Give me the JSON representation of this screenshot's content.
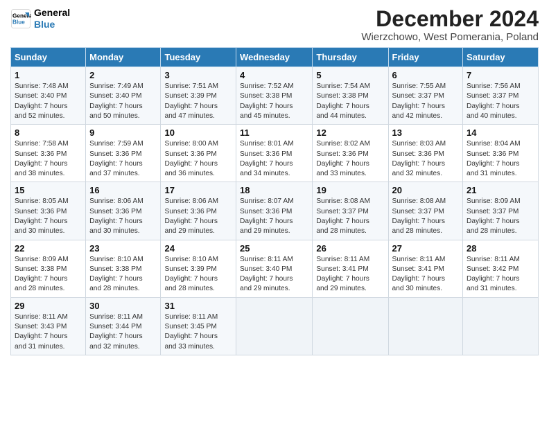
{
  "logo": {
    "line1": "General",
    "line2": "Blue"
  },
  "title": "December 2024",
  "subtitle": "Wierzchowo, West Pomerania, Poland",
  "days_of_week": [
    "Sunday",
    "Monday",
    "Tuesday",
    "Wednesday",
    "Thursday",
    "Friday",
    "Saturday"
  ],
  "weeks": [
    [
      {
        "day": 1,
        "content": "Sunrise: 7:48 AM\nSunset: 3:40 PM\nDaylight: 7 hours\nand 52 minutes."
      },
      {
        "day": 2,
        "content": "Sunrise: 7:49 AM\nSunset: 3:40 PM\nDaylight: 7 hours\nand 50 minutes."
      },
      {
        "day": 3,
        "content": "Sunrise: 7:51 AM\nSunset: 3:39 PM\nDaylight: 7 hours\nand 47 minutes."
      },
      {
        "day": 4,
        "content": "Sunrise: 7:52 AM\nSunset: 3:38 PM\nDaylight: 7 hours\nand 45 minutes."
      },
      {
        "day": 5,
        "content": "Sunrise: 7:54 AM\nSunset: 3:38 PM\nDaylight: 7 hours\nand 44 minutes."
      },
      {
        "day": 6,
        "content": "Sunrise: 7:55 AM\nSunset: 3:37 PM\nDaylight: 7 hours\nand 42 minutes."
      },
      {
        "day": 7,
        "content": "Sunrise: 7:56 AM\nSunset: 3:37 PM\nDaylight: 7 hours\nand 40 minutes."
      }
    ],
    [
      {
        "day": 8,
        "content": "Sunrise: 7:58 AM\nSunset: 3:36 PM\nDaylight: 7 hours\nand 38 minutes."
      },
      {
        "day": 9,
        "content": "Sunrise: 7:59 AM\nSunset: 3:36 PM\nDaylight: 7 hours\nand 37 minutes."
      },
      {
        "day": 10,
        "content": "Sunrise: 8:00 AM\nSunset: 3:36 PM\nDaylight: 7 hours\nand 36 minutes."
      },
      {
        "day": 11,
        "content": "Sunrise: 8:01 AM\nSunset: 3:36 PM\nDaylight: 7 hours\nand 34 minutes."
      },
      {
        "day": 12,
        "content": "Sunrise: 8:02 AM\nSunset: 3:36 PM\nDaylight: 7 hours\nand 33 minutes."
      },
      {
        "day": 13,
        "content": "Sunrise: 8:03 AM\nSunset: 3:36 PM\nDaylight: 7 hours\nand 32 minutes."
      },
      {
        "day": 14,
        "content": "Sunrise: 8:04 AM\nSunset: 3:36 PM\nDaylight: 7 hours\nand 31 minutes."
      }
    ],
    [
      {
        "day": 15,
        "content": "Sunrise: 8:05 AM\nSunset: 3:36 PM\nDaylight: 7 hours\nand 30 minutes."
      },
      {
        "day": 16,
        "content": "Sunrise: 8:06 AM\nSunset: 3:36 PM\nDaylight: 7 hours\nand 30 minutes."
      },
      {
        "day": 17,
        "content": "Sunrise: 8:06 AM\nSunset: 3:36 PM\nDaylight: 7 hours\nand 29 minutes."
      },
      {
        "day": 18,
        "content": "Sunrise: 8:07 AM\nSunset: 3:36 PM\nDaylight: 7 hours\nand 29 minutes."
      },
      {
        "day": 19,
        "content": "Sunrise: 8:08 AM\nSunset: 3:37 PM\nDaylight: 7 hours\nand 28 minutes."
      },
      {
        "day": 20,
        "content": "Sunrise: 8:08 AM\nSunset: 3:37 PM\nDaylight: 7 hours\nand 28 minutes."
      },
      {
        "day": 21,
        "content": "Sunrise: 8:09 AM\nSunset: 3:37 PM\nDaylight: 7 hours\nand 28 minutes."
      }
    ],
    [
      {
        "day": 22,
        "content": "Sunrise: 8:09 AM\nSunset: 3:38 PM\nDaylight: 7 hours\nand 28 minutes."
      },
      {
        "day": 23,
        "content": "Sunrise: 8:10 AM\nSunset: 3:38 PM\nDaylight: 7 hours\nand 28 minutes."
      },
      {
        "day": 24,
        "content": "Sunrise: 8:10 AM\nSunset: 3:39 PM\nDaylight: 7 hours\nand 28 minutes."
      },
      {
        "day": 25,
        "content": "Sunrise: 8:11 AM\nSunset: 3:40 PM\nDaylight: 7 hours\nand 29 minutes."
      },
      {
        "day": 26,
        "content": "Sunrise: 8:11 AM\nSunset: 3:41 PM\nDaylight: 7 hours\nand 29 minutes."
      },
      {
        "day": 27,
        "content": "Sunrise: 8:11 AM\nSunset: 3:41 PM\nDaylight: 7 hours\nand 30 minutes."
      },
      {
        "day": 28,
        "content": "Sunrise: 8:11 AM\nSunset: 3:42 PM\nDaylight: 7 hours\nand 31 minutes."
      }
    ],
    [
      {
        "day": 29,
        "content": "Sunrise: 8:11 AM\nSunset: 3:43 PM\nDaylight: 7 hours\nand 31 minutes."
      },
      {
        "day": 30,
        "content": "Sunrise: 8:11 AM\nSunset: 3:44 PM\nDaylight: 7 hours\nand 32 minutes."
      },
      {
        "day": 31,
        "content": "Sunrise: 8:11 AM\nSunset: 3:45 PM\nDaylight: 7 hours\nand 33 minutes."
      },
      null,
      null,
      null,
      null
    ]
  ]
}
